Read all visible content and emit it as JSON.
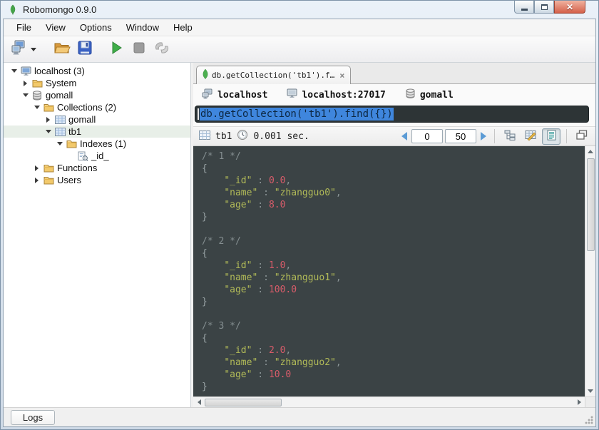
{
  "window": {
    "title": "Robomongo 0.9.0"
  },
  "menu": {
    "items": [
      "File",
      "View",
      "Options",
      "Window",
      "Help"
    ]
  },
  "toolbar": {
    "buttons": [
      "connections-icon",
      "open-icon",
      "save-icon",
      "execute-icon",
      "stop-icon",
      "orientation-icon"
    ]
  },
  "tree": {
    "items": [
      {
        "label": "localhost (3)",
        "level": 0,
        "icon": "server",
        "state": "expanded"
      },
      {
        "label": "System",
        "level": 1,
        "icon": "folder",
        "state": "collapsed"
      },
      {
        "label": "gomall",
        "level": 1,
        "icon": "database",
        "state": "expanded"
      },
      {
        "label": "Collections (2)",
        "level": 2,
        "icon": "folder",
        "state": "expanded"
      },
      {
        "label": "gomall",
        "level": 3,
        "icon": "collection",
        "state": "collapsed"
      },
      {
        "label": "tb1",
        "level": 3,
        "icon": "collection",
        "state": "expanded",
        "selected": true
      },
      {
        "label": "Indexes (1)",
        "level": 4,
        "icon": "folder",
        "state": "expanded"
      },
      {
        "label": "_id_",
        "level": 5,
        "icon": "index",
        "state": "none"
      },
      {
        "label": "Functions",
        "level": 2,
        "icon": "folder",
        "state": "collapsed"
      },
      {
        "label": "Users",
        "level": 2,
        "icon": "folder",
        "state": "collapsed"
      }
    ]
  },
  "tab": {
    "title": "db.getCollection('tb1').f…",
    "close": "×"
  },
  "breadcrumb": {
    "items": [
      {
        "icon": "server-icon",
        "label": "localhost"
      },
      {
        "icon": "monitor-icon",
        "label": "localhost:27017"
      },
      {
        "icon": "database-icon",
        "label": "gomall"
      }
    ]
  },
  "editor": {
    "query": "db.getCollection('tb1').find({})"
  },
  "results_toolbar": {
    "collection": "tb1",
    "duration": "0.001 sec.",
    "skip_value": "0",
    "limit_value": "50",
    "view_modes": [
      "tree-mode",
      "table-mode",
      "text-mode"
    ],
    "active_view": "text-mode"
  },
  "results": {
    "documents": [
      {
        "comment": "/* 1 */",
        "fields": [
          {
            "key": "_id",
            "value": "0.0",
            "kind": "number"
          },
          {
            "key": "name",
            "value": "\"zhangguo0\"",
            "kind": "string"
          },
          {
            "key": "age",
            "value": "8.0",
            "kind": "number"
          }
        ]
      },
      {
        "comment": "/* 2 */",
        "fields": [
          {
            "key": "_id",
            "value": "1.0",
            "kind": "number"
          },
          {
            "key": "name",
            "value": "\"zhangguo1\"",
            "kind": "string"
          },
          {
            "key": "age",
            "value": "100.0",
            "kind": "number"
          }
        ]
      },
      {
        "comment": "/* 3 */",
        "fields": [
          {
            "key": "_id",
            "value": "2.0",
            "kind": "number"
          },
          {
            "key": "name",
            "value": "\"zhangguo2\"",
            "kind": "string"
          },
          {
            "key": "age",
            "value": "10.0",
            "kind": "number"
          }
        ]
      }
    ]
  },
  "status": {
    "logs_label": "Logs"
  },
  "colors": {
    "selection_blue": "#3f86dd",
    "editor_background": "#2d3436",
    "results_background": "#3b4345",
    "json_key": "#b1ba58",
    "json_string": "#b1ba58",
    "json_number": "#d85c6a",
    "json_comment": "#848e90",
    "pagination_arrow": "#5b9bd5",
    "close_button_red": "#d4614a",
    "mongo_green": "#4caf50"
  }
}
